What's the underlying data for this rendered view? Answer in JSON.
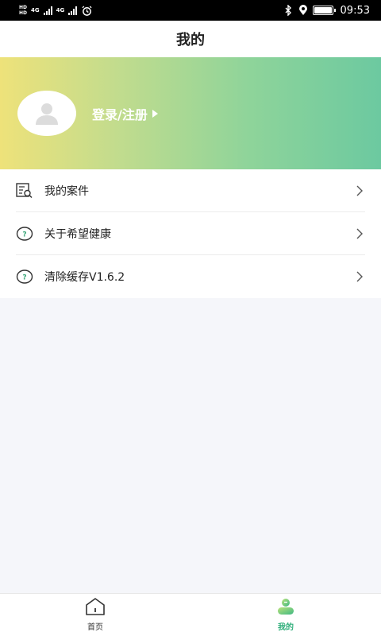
{
  "status_bar": {
    "sim1_tag": [
      "HD",
      "HD"
    ],
    "net1": "4G",
    "net2": "4G",
    "time": "09:53",
    "icons": [
      "signal-icon",
      "alarm-icon",
      "bluetooth-icon",
      "location-icon",
      "battery-icon"
    ]
  },
  "header": {
    "title": "我的"
  },
  "profile": {
    "login_label": "登录/注册",
    "avatar_icon": "user-avatar-icon"
  },
  "menu": {
    "items": [
      {
        "label": "我的案件",
        "icon": "case-search-icon"
      },
      {
        "label": "关于希望健康",
        "icon": "question-circle-icon"
      },
      {
        "label": "清除缓存V1.6.2",
        "icon": "question-circle-icon"
      }
    ]
  },
  "bottom_nav": {
    "tabs": [
      {
        "label": "首页",
        "icon": "home-icon",
        "active": false
      },
      {
        "label": "我的",
        "icon": "profile-icon",
        "active": true
      }
    ]
  },
  "colors": {
    "accent": "#2fae7a",
    "banner_start": "#eee27a",
    "banner_end": "#6cc9a0",
    "background": "#f5f6fa"
  }
}
